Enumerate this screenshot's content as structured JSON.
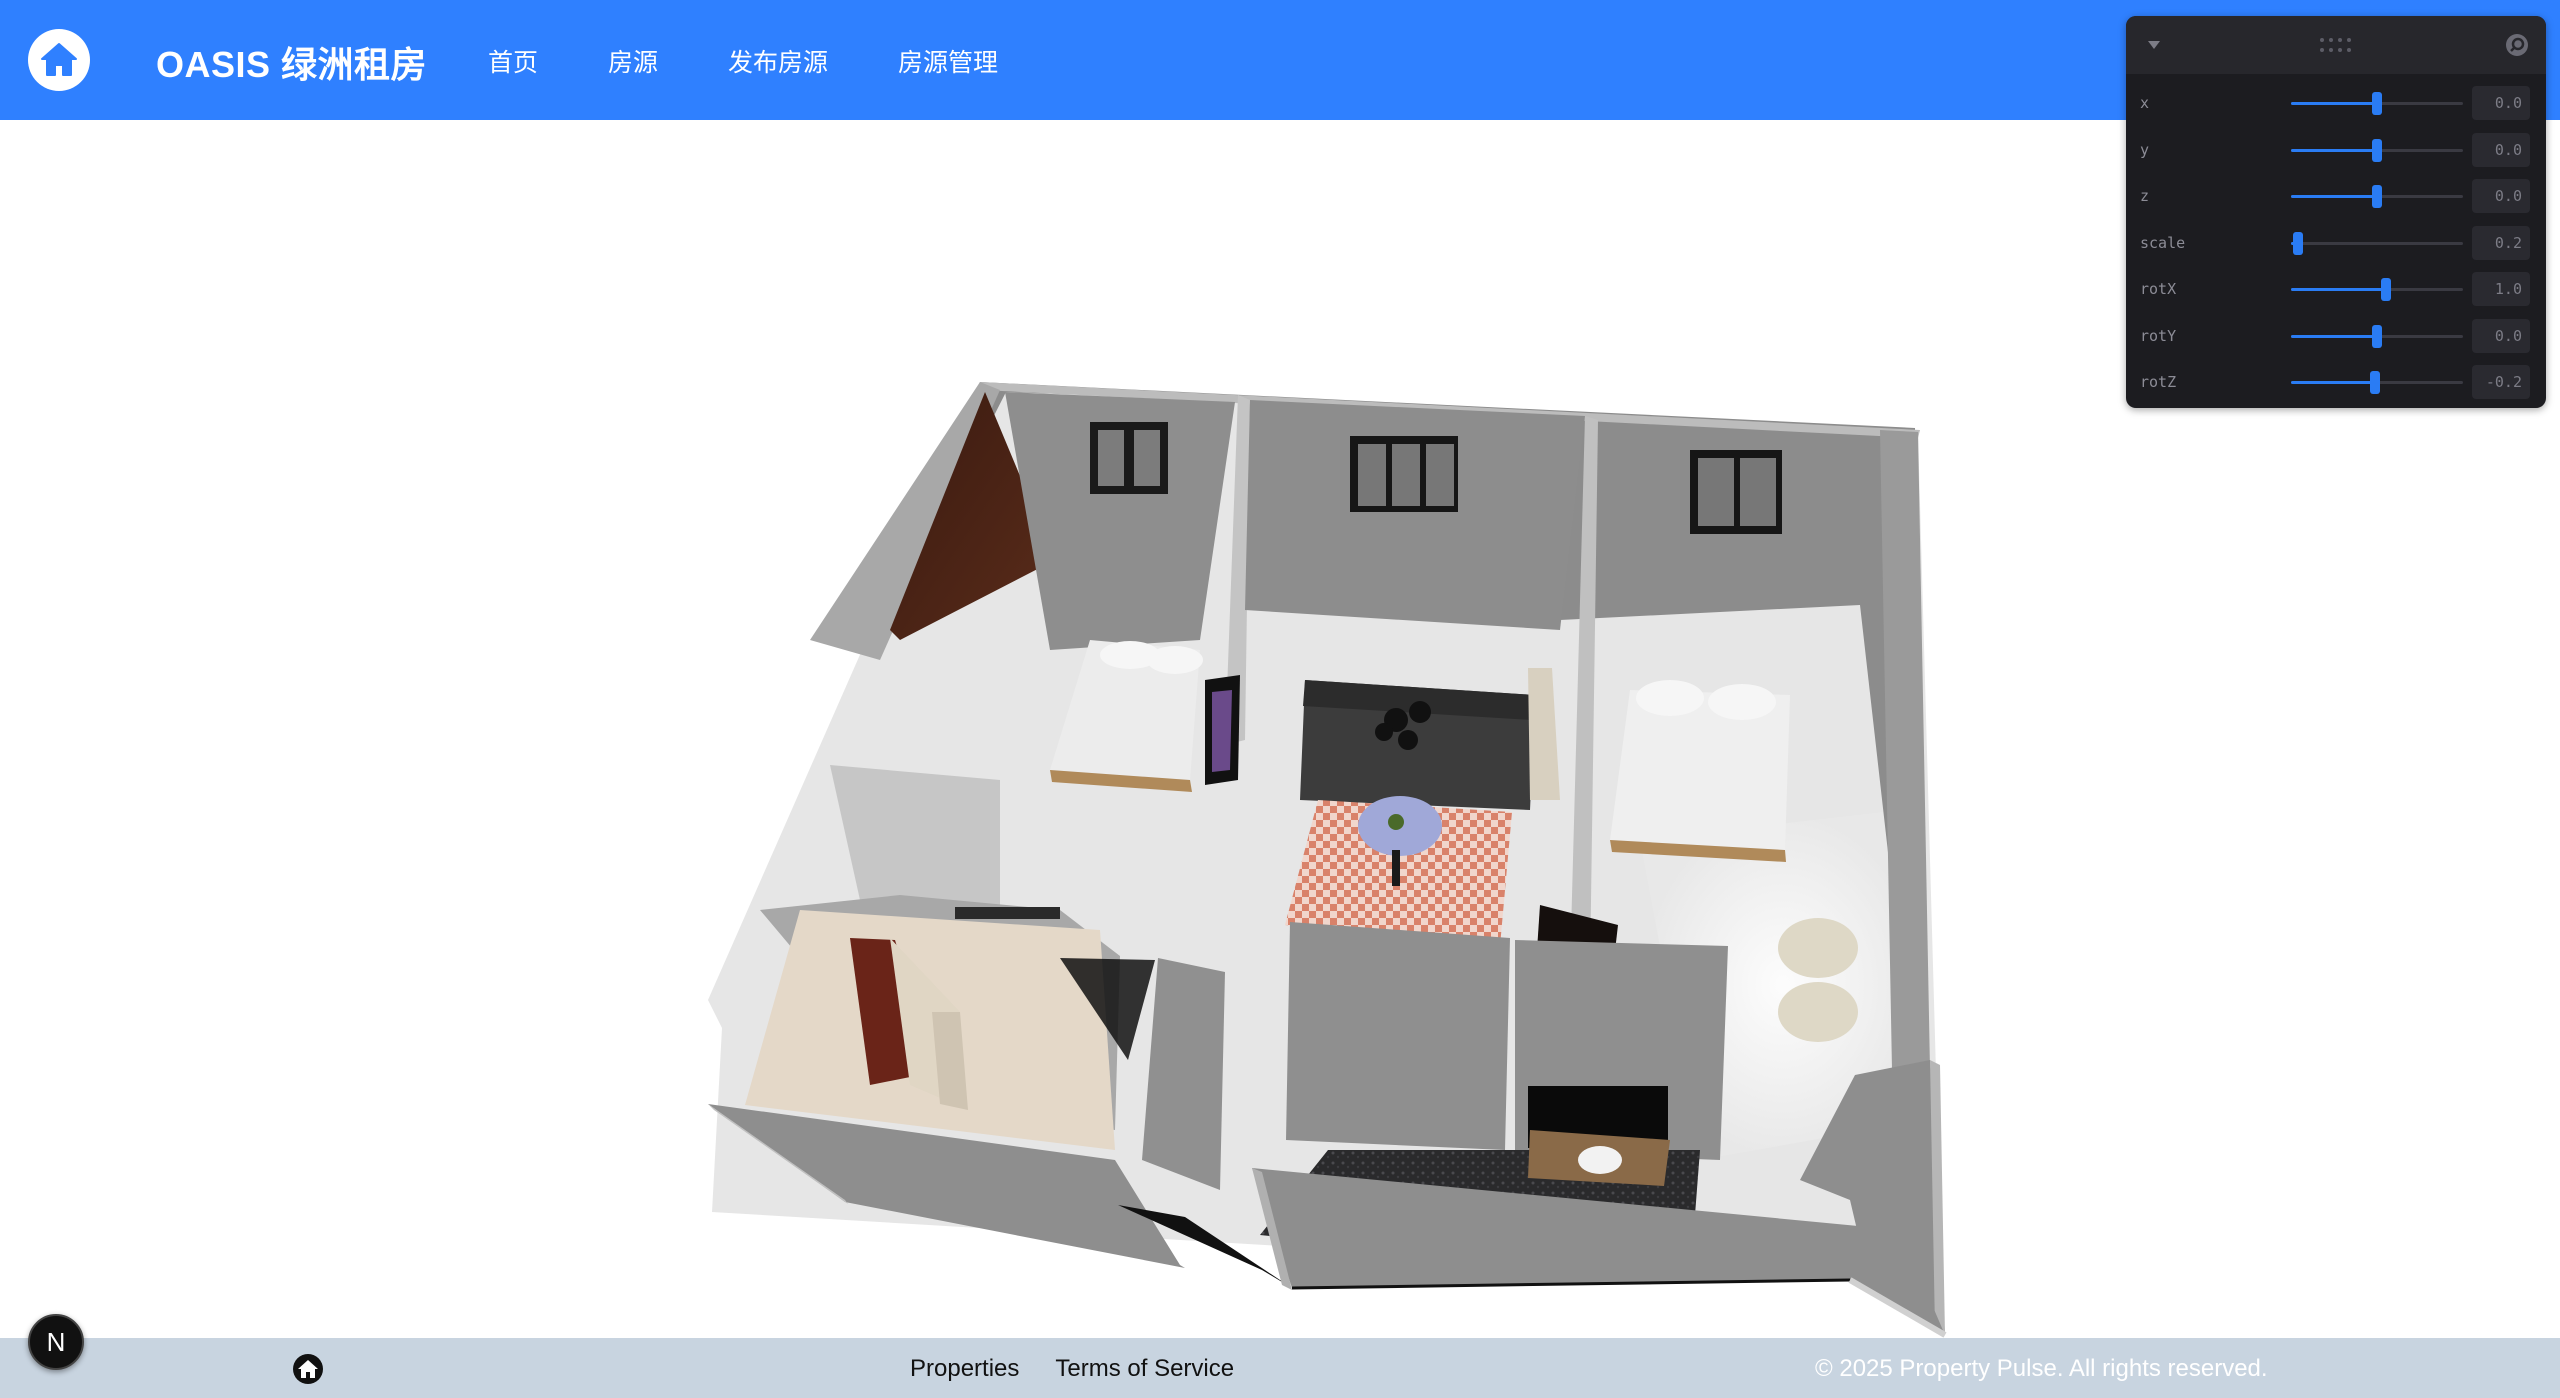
{
  "header": {
    "brand": "OASIS 绿洲租房",
    "nav": [
      "首页",
      "房源",
      "发布房源",
      "房源管理"
    ]
  },
  "controls": {
    "rows": [
      {
        "label": "x",
        "value": "0.0",
        "level": 0.5
      },
      {
        "label": "y",
        "value": "0.0",
        "level": 0.5
      },
      {
        "label": "z",
        "value": "0.0",
        "level": 0.5
      },
      {
        "label": "scale",
        "value": "0.2",
        "level": 0.04
      },
      {
        "label": "rotX",
        "value": "1.0",
        "level": 0.55
      },
      {
        "label": "rotY",
        "value": "0.0",
        "level": 0.5
      },
      {
        "label": "rotZ",
        "value": "-0.2",
        "level": 0.49
      }
    ]
  },
  "footer": {
    "links": [
      "Properties",
      "Terms of Service"
    ],
    "copyright": "© 2025 Property Pulse. All rights reserved."
  },
  "badge": {
    "letter": "N"
  },
  "colors": {
    "primary": "#2f80ff",
    "footer_bg": "#c8d4e0",
    "slider": "#2a7cf4",
    "panel_bg": "#1c1c20"
  },
  "icons": [
    "home-icon",
    "chevron-down-icon",
    "drag-handle-icon",
    "search-icon"
  ]
}
